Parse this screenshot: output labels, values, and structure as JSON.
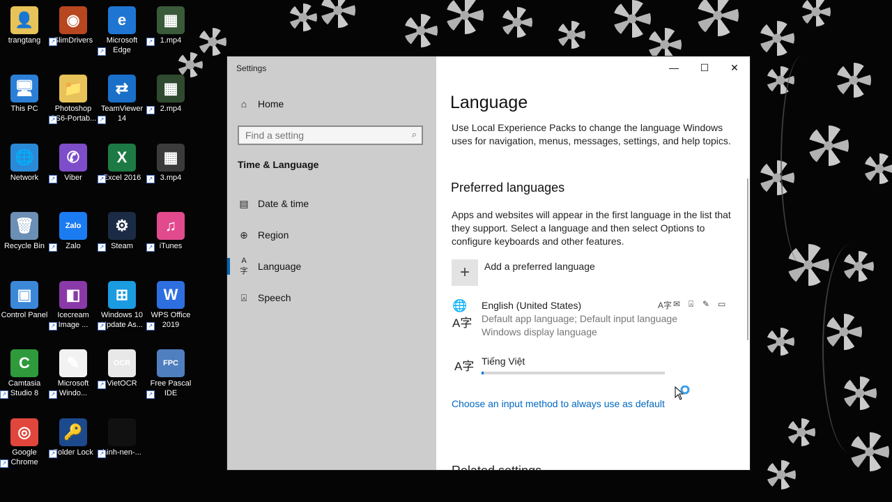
{
  "desktop": {
    "icons": [
      {
        "label": "trangtang",
        "glyph": "👤",
        "bg": "#e8c35a"
      },
      {
        "label": "SlimDrivers",
        "glyph": "◉",
        "bg": "#b8461e"
      },
      {
        "label": "Microsoft Edge",
        "glyph": "e",
        "bg": "#1f76d2"
      },
      {
        "label": "1.mp4",
        "glyph": "▦",
        "bg": "#3a5a3a"
      },
      {
        "label": "This PC",
        "glyph": "🖥",
        "bg": "#2c7fd6"
      },
      {
        "label": "Photoshop CS6-Portab...",
        "glyph": "📁",
        "bg": "#e8c35a"
      },
      {
        "label": "TeamViewer 14",
        "glyph": "⇄",
        "bg": "#1a6fc9"
      },
      {
        "label": "2.mp4",
        "glyph": "▦",
        "bg": "#2f4a2f"
      },
      {
        "label": "Network",
        "glyph": "🌐",
        "bg": "#2b8ad8"
      },
      {
        "label": "Viber",
        "glyph": "✆",
        "bg": "#7e4dc9"
      },
      {
        "label": "Excel 2016",
        "glyph": "X",
        "bg": "#1e7a44"
      },
      {
        "label": "3.mp4",
        "glyph": "▦",
        "bg": "#3b3b3b"
      },
      {
        "label": "Recycle Bin",
        "glyph": "🗑",
        "bg": "#6b8fb5"
      },
      {
        "label": "Zalo",
        "glyph": "Zalo",
        "bg": "#1b7cf2"
      },
      {
        "label": "Steam",
        "glyph": "⚙",
        "bg": "#1c2b45"
      },
      {
        "label": "iTunes",
        "glyph": "♫",
        "bg": "#e14a8c"
      },
      {
        "label": "Control Panel",
        "glyph": "▣",
        "bg": "#3b88d9"
      },
      {
        "label": "Icecream Image ...",
        "glyph": "◧",
        "bg": "#8a3aa8"
      },
      {
        "label": "Windows 10 Update As...",
        "glyph": "⊞",
        "bg": "#1b9be0"
      },
      {
        "label": "WPS Office 2019",
        "glyph": "W",
        "bg": "#2e6fe0"
      },
      {
        "label": "Camtasia Studio 8",
        "glyph": "C",
        "bg": "#2e9a3c"
      },
      {
        "label": "Microsoft Windo...",
        "glyph": "✎",
        "bg": "#f2f2f2"
      },
      {
        "label": "VietOCR",
        "glyph": "OCR",
        "bg": "#e8e8e8"
      },
      {
        "label": "Free Pascal IDE",
        "glyph": "FPC",
        "bg": "#4f7fbf"
      },
      {
        "label": "Google Chrome",
        "glyph": "◎",
        "bg": "#e0463b"
      },
      {
        "label": "Folder Lock",
        "glyph": "🔑",
        "bg": "#1c4a8c"
      },
      {
        "label": "hinh-nen-...",
        "glyph": "",
        "bg": "#111111"
      }
    ]
  },
  "window": {
    "title": "Settings",
    "controls": {
      "minimize": "—",
      "maximize": "☐",
      "close": "✕"
    }
  },
  "sidebar": {
    "home": "Home",
    "search_placeholder": "Find a setting",
    "section": "Time & Language",
    "items": [
      {
        "label": "Date & time",
        "icon": "calendar-clock-icon",
        "glyph": "🗓"
      },
      {
        "label": "Region",
        "icon": "globe-icon",
        "glyph": "⊕"
      },
      {
        "label": "Language",
        "icon": "language-icon",
        "glyph": "A字"
      },
      {
        "label": "Speech",
        "icon": "microphone-icon",
        "glyph": "🎙"
      }
    ]
  },
  "main": {
    "title": "Language",
    "intro": "Use Local Experience Packs to change the language Windows uses for navigation, menus, messages, settings, and help topics.",
    "preferred_heading": "Preferred languages",
    "preferred_desc": "Apps and websites will appear in the first language in the list that they support. Select a language and then select Options to configure keyboards and other features.",
    "add_label": "Add a preferred language",
    "languages": [
      {
        "name": "English (United States)",
        "line1": "Default app language; Default input language",
        "line2": "Windows display language"
      },
      {
        "name": "Tiếng Việt",
        "progress": 0.01
      }
    ],
    "input_link": "Choose an input method to always use as default",
    "cut_heading": "Related settings"
  },
  "colors": {
    "accent": "#0078d7",
    "link": "#0067c0",
    "sidebar": "#cdcdcd"
  }
}
